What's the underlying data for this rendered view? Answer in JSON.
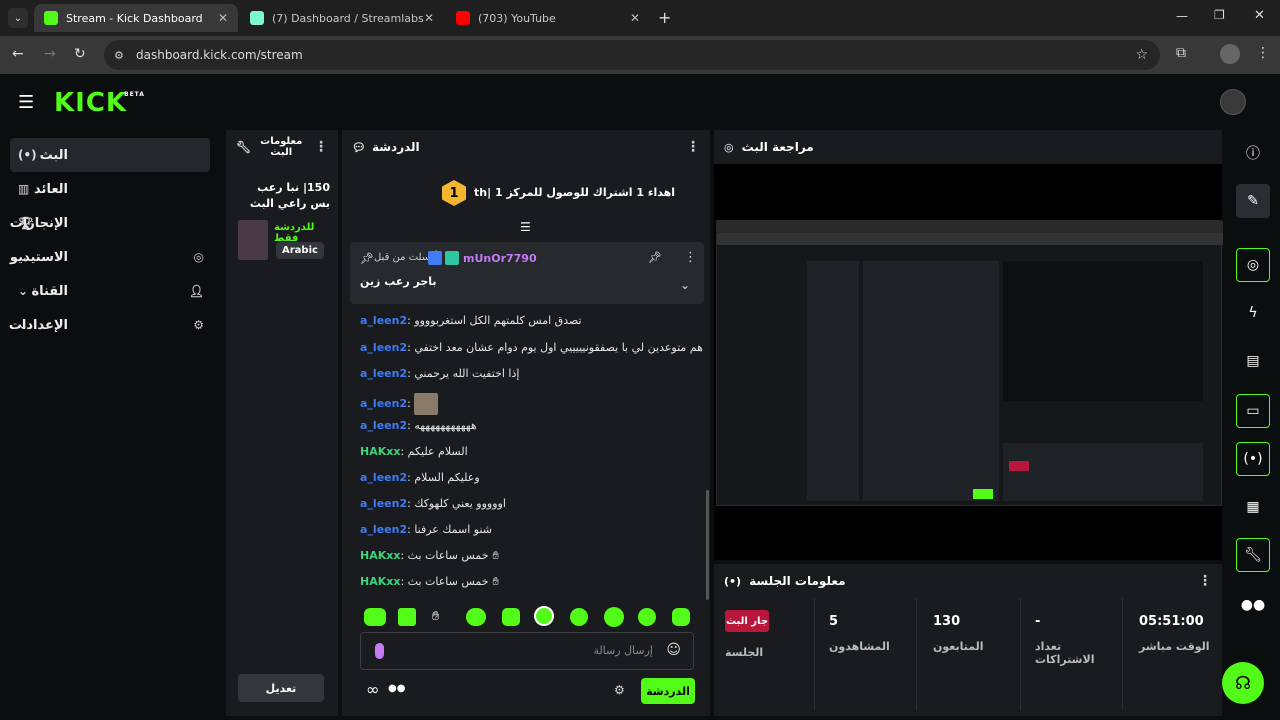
{
  "browser": {
    "tabs": [
      {
        "title": "Stream - Kick Dashboard",
        "color": "#53fc18"
      },
      {
        "title": "(7) Dashboard / Streamlabs",
        "color": "#80f5d2"
      },
      {
        "title": "(703) YouTube",
        "color": "#ff0000"
      }
    ],
    "url": "dashboard.kick.com/stream"
  },
  "kick": {
    "logo": "KICK",
    "beta": "BETA",
    "nav": [
      {
        "label": "البث"
      },
      {
        "label": "العائد"
      },
      {
        "label": "الإنجازات"
      },
      {
        "label": "الاستيديو"
      },
      {
        "label": "القناة"
      },
      {
        "label": "الإعدادات"
      }
    ]
  },
  "stream_info": {
    "title": "معلومات البث",
    "stream_title": "150| نبا رعب بس راعي البث يخاف...",
    "category": "للدردشة فقط",
    "language": "Arabic",
    "edit_label": "تعديل"
  },
  "chat": {
    "title": "الدردشة",
    "goal_text": "اهداء 1 اشتراك للوصول للمركز 1 |th",
    "goal_rank": "1",
    "pinned_from": "أرسلت من قبل",
    "pinned_user": "mUnOr7790",
    "pinned_message": "باجر رعب زين",
    "messages": [
      {
        "user": "a_leen2",
        "text": "تصدق امس كلمتهم الكل استغربوووو",
        "color": "blue"
      },
      {
        "user": "a_leen2",
        "text": "هم متوعدين لي با يصفقونيييييي اول يوم دوام عشان معد اختفي",
        "color": "blue"
      },
      {
        "user": "a_leen2",
        "text": "إذا اختفيت الله يرحمني",
        "color": "blue"
      },
      {
        "user": "a_leen2",
        "text": "",
        "color": "blue"
      },
      {
        "user": "a_leen2",
        "text": "هههههههههههه",
        "color": "blue"
      },
      {
        "user": "HAKxx",
        "text": "السلام عليكم",
        "color": "green"
      },
      {
        "user": "a_leen2",
        "text": "وعليكم السلام",
        "color": "blue"
      },
      {
        "user": "a_leen2",
        "text": "اووووو يعني كلهوكك",
        "color": "blue"
      },
      {
        "user": "a_leen2",
        "text": "شنو اسمك عرفنا",
        "color": "blue"
      },
      {
        "user": "HAKxx",
        "text": "خمس ساعات بث",
        "color": "green"
      },
      {
        "user": "HAKxx",
        "text": "خمس ساعات بث",
        "color": "green"
      }
    ],
    "input_placeholder": "إرسال رسالة",
    "send_label": "الدردشة"
  },
  "preview": {
    "title": "مراجعة البث"
  },
  "session": {
    "title": "معلومات الجلسة",
    "live_badge": "جار البث",
    "session_label": "الجلسة",
    "stats": [
      {
        "value": "5",
        "label": "المشاهدون"
      },
      {
        "value": "130",
        "label": "المتابعون"
      },
      {
        "value": "-",
        "label": "تعداد الاشتراكات"
      },
      {
        "value": "05:51:00",
        "label": "الوقت مباشر"
      }
    ]
  },
  "colors": {
    "accent": "#53fc18",
    "panel": "#191b1f",
    "background": "#0b0e0f"
  }
}
